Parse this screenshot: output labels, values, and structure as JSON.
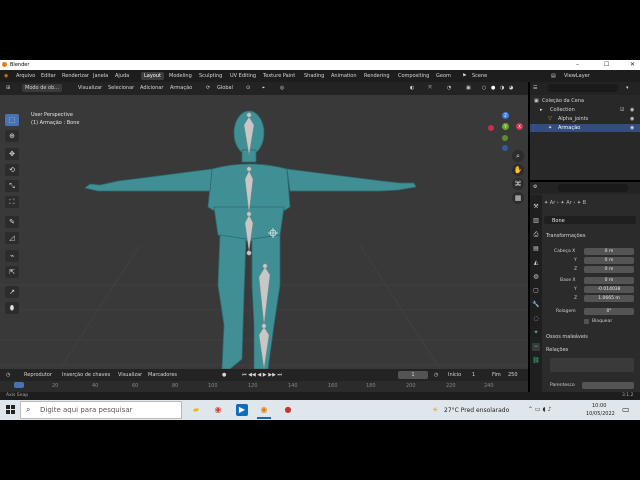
{
  "window": {
    "title": "Blender"
  },
  "menu": {
    "items": [
      "Arquivo",
      "Editar",
      "Renderizar",
      "Janela",
      "Ajuda"
    ],
    "workspaces": [
      "Layout",
      "Modeling",
      "Sculpting",
      "UV Editing",
      "Texture Paint",
      "Shading",
      "Animation",
      "Rendering",
      "Compositing",
      "Geom"
    ],
    "scene": "Scene",
    "view_layer": "ViewLayer"
  },
  "viewport_header": {
    "mode": "Modo de ob...",
    "menus": [
      "Visualizar",
      "Selecionar",
      "Adicionar",
      "Armação"
    ],
    "orientation": "Global",
    "options": "Opções"
  },
  "viewport": {
    "overlay_title": "User Perspective",
    "overlay_sub": "(1) Armação : Bone",
    "gizmo": {
      "x": "X",
      "y": "Y",
      "z": "Z"
    }
  },
  "outliner": {
    "scene_collection": "Coleção da Cena",
    "items": [
      {
        "label": "Collection"
      },
      {
        "label": "Alpha_joints"
      },
      {
        "label": "Armação"
      }
    ]
  },
  "properties": {
    "bone_name": "Bone",
    "sections": {
      "transform": "Transformações",
      "deform": "Ossos maleáveis",
      "relations": "Relações",
      "parent_label": "Parentesco"
    },
    "head": {
      "label": "Cabeça X",
      "x": "0 m",
      "y_label": "Y",
      "y": "0 m",
      "z_label": "Z",
      "z": "0 m"
    },
    "tail": {
      "label": "Base X",
      "x": "0 m",
      "y_label": "Y",
      "y": "-0.014038",
      "z_label": "Z",
      "z": "1.0665 m"
    },
    "roll": {
      "label": "Rolagem",
      "value": "0°"
    },
    "lock": "Bloquear"
  },
  "timeline": {
    "menus": [
      "Reprodutor",
      "Inserção de chaves",
      "Visualizar",
      "Marcadores"
    ],
    "current_frame": "1",
    "start_label": "Início",
    "start": "1",
    "end_label": "Fim",
    "end": "250",
    "ruler": [
      "0",
      "20",
      "40",
      "60",
      "80",
      "100",
      "120",
      "140",
      "160",
      "180",
      "200",
      "220",
      "240"
    ]
  },
  "statusbar": {
    "left": "Axis Snap",
    "version": "3.1.2"
  },
  "taskbar": {
    "search_placeholder": "Digite aqui para pesquisar",
    "weather": "27°C  Pred ensolarado",
    "time": "10:00",
    "date": "10/05/2022"
  }
}
